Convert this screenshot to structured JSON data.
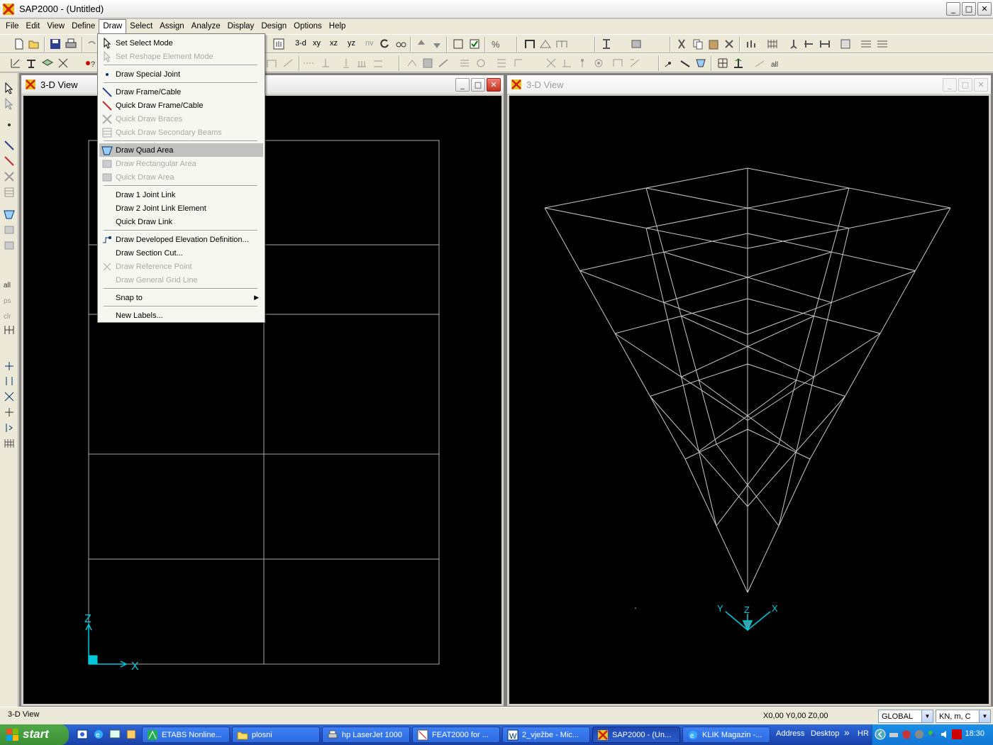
{
  "window": {
    "title": "SAP2000 - (Untitled)",
    "minimize": "_",
    "maximize": "□",
    "close": "✕"
  },
  "menubar": [
    "File",
    "Edit",
    "View",
    "Define",
    "Draw",
    "Select",
    "Assign",
    "Analyze",
    "Display",
    "Design",
    "Options",
    "Help"
  ],
  "toolbar": {
    "view_3d": "3-d",
    "view_xy": "xy",
    "view_xz": "xz",
    "view_yz": "yz",
    "view_nv": "nv"
  },
  "draw_menu": [
    {
      "label": "Set Select Mode",
      "enabled": true,
      "icon": "pointer-icon"
    },
    {
      "label": "Set Reshape Element Mode",
      "enabled": false,
      "icon": "reshape-pointer-icon"
    },
    {
      "label": "Draw Special Joint",
      "enabled": true,
      "icon": "joint-dot-icon"
    },
    {
      "label": "Draw Frame/Cable",
      "enabled": true,
      "icon": "frame-line-icon"
    },
    {
      "label": "Quick Draw Frame/Cable",
      "enabled": true,
      "icon": "quick-frame-icon"
    },
    {
      "label": "Quick Draw Braces",
      "enabled": false,
      "icon": "braces-icon"
    },
    {
      "label": "Quick Draw Secondary Beams",
      "enabled": false,
      "icon": "secondary-beams-icon"
    },
    {
      "label": "Draw Quad Area",
      "enabled": true,
      "highlighted": true,
      "icon": "quad-area-icon"
    },
    {
      "label": "Draw Rectangular Area",
      "enabled": false,
      "icon": "rect-area-icon"
    },
    {
      "label": "Quick Draw Area",
      "enabled": false,
      "icon": "quick-area-icon"
    },
    {
      "label": "Draw 1 Joint Link",
      "enabled": true
    },
    {
      "label": "Draw 2 Joint Link Element",
      "enabled": true
    },
    {
      "label": "Quick Draw Link",
      "enabled": true
    },
    {
      "label": "Draw Developed Elevation Definition...",
      "enabled": true,
      "icon": "elevation-icon"
    },
    {
      "label": "Draw Section Cut...",
      "enabled": true
    },
    {
      "label": "Draw Reference Point",
      "enabled": false,
      "icon": "reference-point-icon"
    },
    {
      "label": "Draw General Grid Line",
      "enabled": false
    },
    {
      "label": "Snap to",
      "enabled": true,
      "submenu": true
    },
    {
      "label": "New Labels...",
      "enabled": true
    }
  ],
  "views": [
    {
      "title": "3-D View",
      "active": true,
      "axes": {
        "vertical": "Z",
        "horizontal": "X"
      }
    },
    {
      "title": "3-D View",
      "active": false,
      "axes": {
        "x": "X",
        "y": "Y",
        "z": "Z"
      }
    }
  ],
  "statusbar": {
    "view_name": "3-D View",
    "coords": "X0,00  Y0,00  Z0,00",
    "coord_system": "GLOBAL",
    "units": "KN, m, C"
  },
  "taskbar": {
    "start": "start",
    "tasks": [
      {
        "label": "ETABS Nonline...",
        "active": false
      },
      {
        "label": "plosni",
        "active": false
      },
      {
        "label": "hp LaserJet 1000",
        "active": false
      },
      {
        "label": "FEAT2000 for ...",
        "active": false
      },
      {
        "label": "2_vježbe - Mic...",
        "active": false
      },
      {
        "label": "SAP2000 - (Un...",
        "active": true
      },
      {
        "label": "KLIK Magazin -...",
        "active": false
      }
    ],
    "address": "Address",
    "desktop": "Desktop",
    "chevron": "»",
    "lang": "HR",
    "clock": "18:30"
  },
  "colors": {
    "axis": "#00c8d8",
    "grid": "#c8c8c8",
    "canvas": "#000000",
    "highlight": "#c1c1c1"
  }
}
